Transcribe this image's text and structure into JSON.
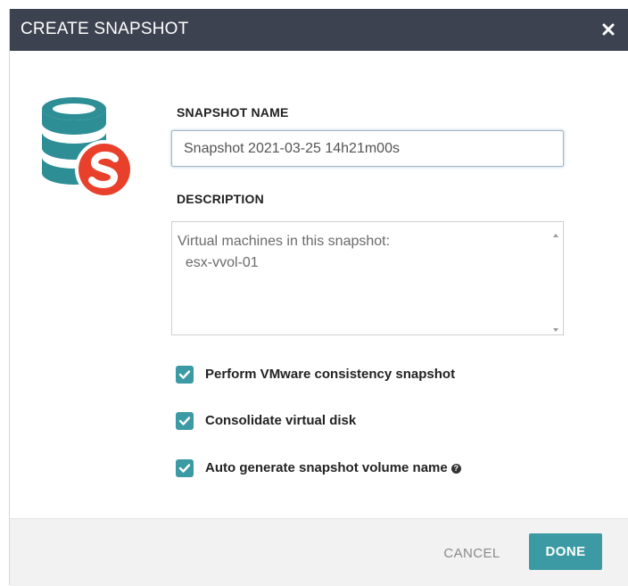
{
  "dialog": {
    "title": "CREATE SNAPSHOT",
    "close_icon": "close-icon",
    "app_icon": "snapshot-database-icon"
  },
  "form": {
    "name_label": "SNAPSHOT NAME",
    "name_value": "Snapshot 2021-03-25 14h21m00s",
    "description_label": "DESCRIPTION",
    "description_value": "Virtual machines in this snapshot:\n  esx-vvol-01"
  },
  "options": [
    {
      "label": "Perform VMware consistency snapshot",
      "checked": true
    },
    {
      "label": "Consolidate virtual disk",
      "checked": true
    },
    {
      "label": "Auto generate snapshot volume name",
      "checked": true,
      "help_icon": "help-icon"
    }
  ],
  "footer": {
    "cancel_label": "CANCEL",
    "done_label": "DONE"
  },
  "colors": {
    "titlebar": "#3d4250",
    "accent": "#3c9aa4",
    "logo_red": "#e8402b",
    "logo_teal": "#2e8e96"
  }
}
